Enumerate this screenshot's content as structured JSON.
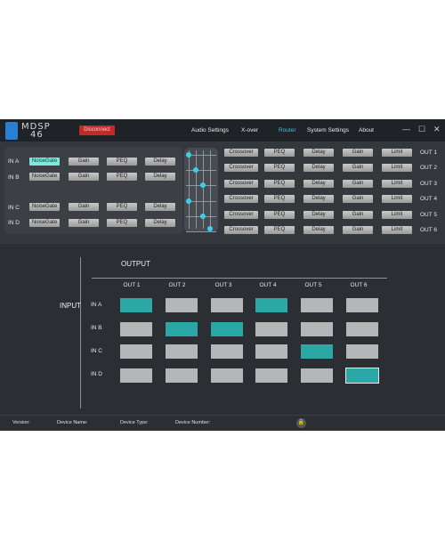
{
  "app": {
    "logo_line1": "MDSP",
    "logo_line2": "46",
    "disconnect_label": "Disconnect"
  },
  "nav": [
    {
      "label": "Audio Settings",
      "active": false
    },
    {
      "label": "X-over",
      "active": false
    },
    {
      "label": "Router",
      "active": true
    },
    {
      "label": "System Settings",
      "active": false
    },
    {
      "label": "About",
      "active": false
    }
  ],
  "window_buttons": {
    "minimize": "—",
    "maximize": "☐",
    "close": "✕"
  },
  "inputs": [
    {
      "label": "IN A",
      "noisegate": "NoiseGate",
      "noisegate_active": true,
      "gain": "Gain",
      "peq": "PEQ",
      "delay": "Delay"
    },
    {
      "label": "IN B",
      "noisegate": "NoiseGate",
      "noisegate_active": false,
      "gain": "Gain",
      "peq": "PEQ",
      "delay": "Delay"
    },
    {
      "label": "IN C",
      "noisegate": "NoiseGate",
      "noisegate_active": false,
      "gain": "Gain",
      "peq": "PEQ",
      "delay": "Delay"
    },
    {
      "label": "IN D",
      "noisegate": "NoiseGate",
      "noisegate_active": false,
      "gain": "Gain",
      "peq": "PEQ",
      "delay": "Delay"
    }
  ],
  "outputs": [
    {
      "label": "OUT 1",
      "crossover": "Crossover",
      "peq": "PEQ",
      "delay": "Delay",
      "gain": "Gain",
      "limit": "Limit"
    },
    {
      "label": "OUT 2",
      "crossover": "Crossover",
      "peq": "PEQ",
      "delay": "Delay",
      "gain": "Gain",
      "limit": "Limit"
    },
    {
      "label": "OUT 3",
      "crossover": "Crossover",
      "peq": "PEQ",
      "delay": "Delay",
      "gain": "Gain",
      "limit": "Limit"
    },
    {
      "label": "OUT 4",
      "crossover": "Crossover",
      "peq": "PEQ",
      "delay": "Delay",
      "gain": "Gain",
      "limit": "Limit"
    },
    {
      "label": "OUT 5",
      "crossover": "Crossover",
      "peq": "PEQ",
      "delay": "Delay",
      "gain": "Gain",
      "limit": "Limit"
    },
    {
      "label": "OUT 6",
      "crossover": "Crossover",
      "peq": "PEQ",
      "delay": "Delay",
      "gain": "Gain",
      "limit": "Limit"
    }
  ],
  "matrix": {
    "output_title": "OUTPUT",
    "input_title": "INPUT",
    "columns": [
      "OUT 1",
      "OUT 2",
      "OUT 3",
      "OUT 4",
      "OUT 5",
      "OUT 6"
    ],
    "rows": [
      {
        "label": "IN A",
        "cells": [
          1,
          0,
          0,
          1,
          0,
          0
        ]
      },
      {
        "label": "IN B",
        "cells": [
          0,
          1,
          1,
          0,
          0,
          0
        ]
      },
      {
        "label": "IN C",
        "cells": [
          0,
          0,
          0,
          0,
          1,
          0
        ]
      },
      {
        "label": "IN D",
        "cells": [
          0,
          0,
          0,
          0,
          0,
          1
        ]
      }
    ],
    "selected_cell": {
      "row": 3,
      "col": 5
    }
  },
  "colors": {
    "accent": "#39c6d8",
    "matrix_on": "#2ba7a6",
    "matrix_off": "#b5b6b8",
    "disconnect": "#c62828"
  },
  "status": {
    "version_label": "Version:",
    "device_name_label": "Device Name:",
    "device_type_label": "Device Type:",
    "device_number_label": "Device Number:",
    "lock_icon": "🔒"
  }
}
